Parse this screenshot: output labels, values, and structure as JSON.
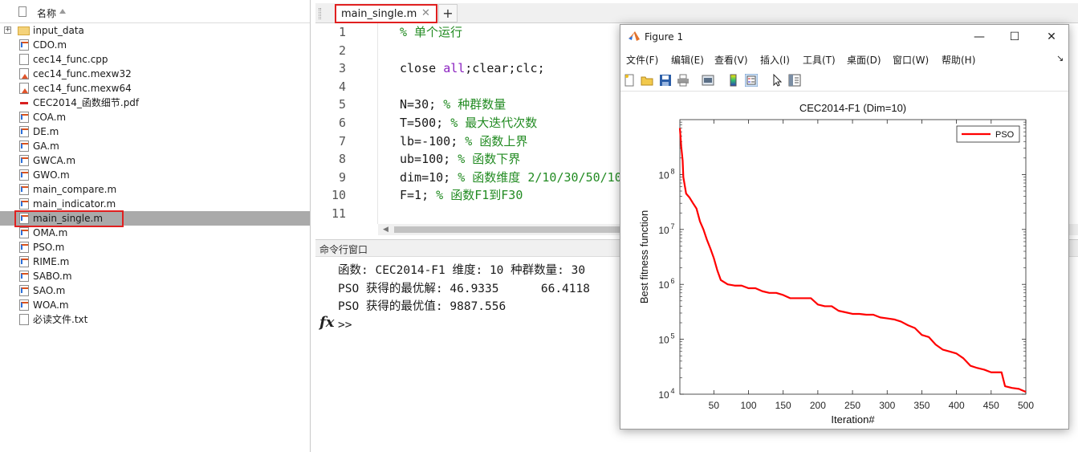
{
  "file_browser": {
    "header_label": "名称",
    "files": [
      {
        "name": "input_data",
        "icon": "folder-icon",
        "expandable": true
      },
      {
        "name": "CDO.m",
        "icon": "m-file-icon"
      },
      {
        "name": "cec14_func.cpp",
        "icon": "document-icon"
      },
      {
        "name": "cec14_func.mexw32",
        "icon": "mex-file-icon"
      },
      {
        "name": "cec14_func.mexw64",
        "icon": "mex-file-icon"
      },
      {
        "name": "CEC2014_函数细节.pdf",
        "icon": "pdf-file-icon"
      },
      {
        "name": "COA.m",
        "icon": "m-file-icon"
      },
      {
        "name": "DE.m",
        "icon": "m-file-icon"
      },
      {
        "name": "GA.m",
        "icon": "m-file-icon"
      },
      {
        "name": "GWCA.m",
        "icon": "m-file-icon"
      },
      {
        "name": "GWO.m",
        "icon": "m-file-icon"
      },
      {
        "name": "main_compare.m",
        "icon": "m-file-icon"
      },
      {
        "name": "main_indicator.m",
        "icon": "m-file-icon"
      },
      {
        "name": "main_single.m",
        "icon": "m-file-icon",
        "selected": true
      },
      {
        "name": "OMA.m",
        "icon": "m-file-icon"
      },
      {
        "name": "PSO.m",
        "icon": "m-file-icon"
      },
      {
        "name": "RIME.m",
        "icon": "m-file-icon"
      },
      {
        "name": "SABO.m",
        "icon": "m-file-icon"
      },
      {
        "name": "SAO.m",
        "icon": "m-file-icon"
      },
      {
        "name": "WOA.m",
        "icon": "m-file-icon"
      },
      {
        "name": "必读文件.txt",
        "icon": "document-icon"
      }
    ]
  },
  "editor": {
    "tab_label": "main_single.m",
    "tab_close": "✕",
    "new_tab": "+",
    "lines": [
      {
        "num": "1",
        "code": "",
        "comment": "% 单个运行"
      },
      {
        "num": "2",
        "code": "",
        "comment": ""
      },
      {
        "num": "3",
        "code": "close ",
        "kw": "all",
        "code2": ";clear;clc;",
        "comment": ""
      },
      {
        "num": "4",
        "code": "",
        "comment": ""
      },
      {
        "num": "5",
        "code": "N=30; ",
        "comment": "% 种群数量"
      },
      {
        "num": "6",
        "code": "T=500; ",
        "comment": "% 最大迭代次数"
      },
      {
        "num": "7",
        "code": "lb=-100; ",
        "comment": "% 函数上界"
      },
      {
        "num": "8",
        "code": "ub=100; ",
        "comment": "% 函数下界"
      },
      {
        "num": "9",
        "code": "dim=10; ",
        "comment": "% 函数维度 2/10/30/50/100"
      },
      {
        "num": "10",
        "code": "F=1; ",
        "comment": "% 函数F1到F30"
      },
      {
        "num": "11",
        "code": "",
        "comment": ""
      }
    ]
  },
  "command_window": {
    "title": "命令行窗口",
    "fx_label": "fx",
    "output": [
      "函数: CEC2014-F1 维度: 10 种群数量: 30",
      "PSO 获得的最优解: 46.9335      66.4118",
      "PSO 获得的最优值: 9887.556"
    ],
    "prompt": ">>"
  },
  "figure": {
    "title": "Figure 1",
    "window_buttons": {
      "minimize": "—",
      "maximize": "☐",
      "close": "✕"
    },
    "menus": [
      "文件(F)",
      "编辑(E)",
      "查看(V)",
      "插入(I)",
      "工具(T)",
      "桌面(D)",
      "窗口(W)",
      "帮助(H)"
    ],
    "menu_overflow": "↘",
    "toolbar": [
      "new-figure-icon",
      "open-icon",
      "save-icon",
      "print-icon",
      "link-plot-icon",
      "colorbar-icon",
      "legend-icon",
      "pointer-icon",
      "property-editor-icon"
    ]
  },
  "chart_data": {
    "type": "line",
    "title": "CEC2014-F1 (Dim=10)",
    "xlabel": "Iteration#",
    "ylabel": "Best fitness function",
    "y_scale": "log",
    "xlim": [
      1,
      500
    ],
    "ylim": [
      10000,
      1000000000
    ],
    "x_ticks": [
      50,
      100,
      150,
      200,
      250,
      300,
      350,
      400,
      450,
      500
    ],
    "y_ticks": [
      {
        "value": 10000,
        "base": "10",
        "exp": "4"
      },
      {
        "value": 100000,
        "base": "10",
        "exp": "5"
      },
      {
        "value": 1000000,
        "base": "10",
        "exp": "6"
      },
      {
        "value": 10000000,
        "base": "10",
        "exp": "7"
      },
      {
        "value": 100000000,
        "base": "10",
        "exp": "8"
      }
    ],
    "grid": false,
    "legend_position": "top-right",
    "series": [
      {
        "name": "PSO",
        "color": "#ff0000",
        "x": [
          1,
          3,
          5,
          6,
          10,
          15,
          20,
          25,
          30,
          35,
          40,
          45,
          50,
          55,
          60,
          70,
          80,
          90,
          100,
          110,
          120,
          130,
          140,
          150,
          160,
          170,
          180,
          190,
          200,
          210,
          220,
          230,
          240,
          250,
          260,
          270,
          280,
          290,
          300,
          310,
          320,
          330,
          340,
          350,
          360,
          370,
          380,
          390,
          400,
          410,
          420,
          430,
          440,
          450,
          460,
          465,
          470,
          480,
          490,
          500
        ],
        "y": [
          700000000,
          320000000,
          180000000,
          90000000,
          45000000,
          38000000,
          30000000,
          24000000,
          14000000,
          10000000,
          6500000,
          4500000,
          3000000,
          1800000,
          1200000,
          1000000,
          950000,
          950000,
          850000,
          850000,
          750000,
          700000,
          700000,
          640000,
          560000,
          560000,
          560000,
          560000,
          430000,
          400000,
          400000,
          330000,
          310000,
          290000,
          290000,
          280000,
          280000,
          250000,
          240000,
          230000,
          210000,
          180000,
          160000,
          120000,
          110000,
          80000,
          65000,
          60000,
          55000,
          45000,
          33000,
          30000,
          28000,
          25000,
          25000,
          25000,
          14000,
          13000,
          12500,
          11000
        ]
      }
    ]
  }
}
